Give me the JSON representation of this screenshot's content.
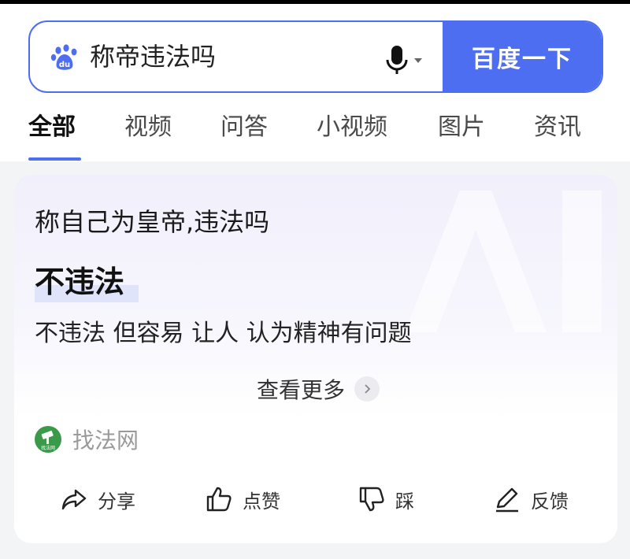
{
  "search": {
    "query": "称帝违法吗",
    "button_label": "百度一下",
    "logo_icon": "baidu-paw-icon",
    "mic_icon": "microphone-icon"
  },
  "tabs": [
    {
      "label": "全部",
      "active": true
    },
    {
      "label": "视频"
    },
    {
      "label": "问答"
    },
    {
      "label": "小视频"
    },
    {
      "label": "图片"
    },
    {
      "label": "资讯"
    }
  ],
  "answer_card": {
    "question": "称自己为皇帝,违法吗",
    "answer": "不违法",
    "detail": "不违法 但容易 让人 认为精神有问题",
    "more_label": "查看更多",
    "source": {
      "name": "找法网",
      "icon": "zhaofawang-logo-icon"
    },
    "actions": [
      {
        "label": "分享",
        "icon": "share-icon"
      },
      {
        "label": "点赞",
        "icon": "thumbs-up-icon"
      },
      {
        "label": "踩",
        "icon": "thumbs-down-icon"
      },
      {
        "label": "反馈",
        "icon": "pencil-icon"
      }
    ]
  },
  "colors": {
    "accent": "#4e6ef2",
    "card_tint": "#f1effb",
    "source_green": "#3a9a4a"
  }
}
